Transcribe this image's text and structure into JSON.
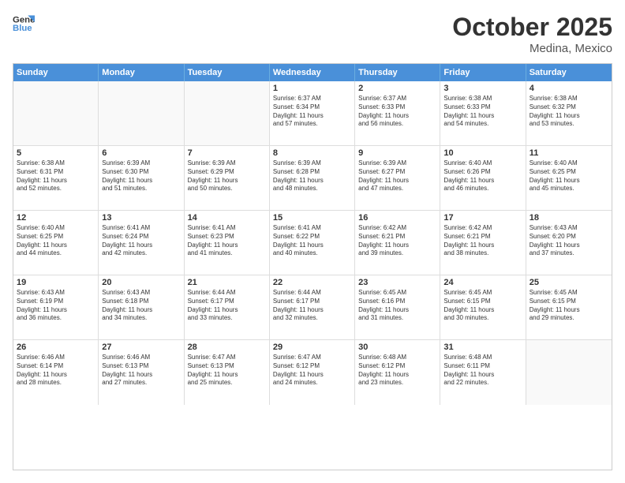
{
  "logo": {
    "line1": "General",
    "line2": "Blue"
  },
  "header": {
    "month_year": "October 2025",
    "location": "Medina, Mexico"
  },
  "day_headers": [
    "Sunday",
    "Monday",
    "Tuesday",
    "Wednesday",
    "Thursday",
    "Friday",
    "Saturday"
  ],
  "weeks": [
    [
      {
        "date": "",
        "info": ""
      },
      {
        "date": "",
        "info": ""
      },
      {
        "date": "",
        "info": ""
      },
      {
        "date": "1",
        "info": "Sunrise: 6:37 AM\nSunset: 6:34 PM\nDaylight: 11 hours\nand 57 minutes."
      },
      {
        "date": "2",
        "info": "Sunrise: 6:37 AM\nSunset: 6:33 PM\nDaylight: 11 hours\nand 56 minutes."
      },
      {
        "date": "3",
        "info": "Sunrise: 6:38 AM\nSunset: 6:33 PM\nDaylight: 11 hours\nand 54 minutes."
      },
      {
        "date": "4",
        "info": "Sunrise: 6:38 AM\nSunset: 6:32 PM\nDaylight: 11 hours\nand 53 minutes."
      }
    ],
    [
      {
        "date": "5",
        "info": "Sunrise: 6:38 AM\nSunset: 6:31 PM\nDaylight: 11 hours\nand 52 minutes."
      },
      {
        "date": "6",
        "info": "Sunrise: 6:39 AM\nSunset: 6:30 PM\nDaylight: 11 hours\nand 51 minutes."
      },
      {
        "date": "7",
        "info": "Sunrise: 6:39 AM\nSunset: 6:29 PM\nDaylight: 11 hours\nand 50 minutes."
      },
      {
        "date": "8",
        "info": "Sunrise: 6:39 AM\nSunset: 6:28 PM\nDaylight: 11 hours\nand 48 minutes."
      },
      {
        "date": "9",
        "info": "Sunrise: 6:39 AM\nSunset: 6:27 PM\nDaylight: 11 hours\nand 47 minutes."
      },
      {
        "date": "10",
        "info": "Sunrise: 6:40 AM\nSunset: 6:26 PM\nDaylight: 11 hours\nand 46 minutes."
      },
      {
        "date": "11",
        "info": "Sunrise: 6:40 AM\nSunset: 6:25 PM\nDaylight: 11 hours\nand 45 minutes."
      }
    ],
    [
      {
        "date": "12",
        "info": "Sunrise: 6:40 AM\nSunset: 6:25 PM\nDaylight: 11 hours\nand 44 minutes."
      },
      {
        "date": "13",
        "info": "Sunrise: 6:41 AM\nSunset: 6:24 PM\nDaylight: 11 hours\nand 42 minutes."
      },
      {
        "date": "14",
        "info": "Sunrise: 6:41 AM\nSunset: 6:23 PM\nDaylight: 11 hours\nand 41 minutes."
      },
      {
        "date": "15",
        "info": "Sunrise: 6:41 AM\nSunset: 6:22 PM\nDaylight: 11 hours\nand 40 minutes."
      },
      {
        "date": "16",
        "info": "Sunrise: 6:42 AM\nSunset: 6:21 PM\nDaylight: 11 hours\nand 39 minutes."
      },
      {
        "date": "17",
        "info": "Sunrise: 6:42 AM\nSunset: 6:21 PM\nDaylight: 11 hours\nand 38 minutes."
      },
      {
        "date": "18",
        "info": "Sunrise: 6:43 AM\nSunset: 6:20 PM\nDaylight: 11 hours\nand 37 minutes."
      }
    ],
    [
      {
        "date": "19",
        "info": "Sunrise: 6:43 AM\nSunset: 6:19 PM\nDaylight: 11 hours\nand 36 minutes."
      },
      {
        "date": "20",
        "info": "Sunrise: 6:43 AM\nSunset: 6:18 PM\nDaylight: 11 hours\nand 34 minutes."
      },
      {
        "date": "21",
        "info": "Sunrise: 6:44 AM\nSunset: 6:17 PM\nDaylight: 11 hours\nand 33 minutes."
      },
      {
        "date": "22",
        "info": "Sunrise: 6:44 AM\nSunset: 6:17 PM\nDaylight: 11 hours\nand 32 minutes."
      },
      {
        "date": "23",
        "info": "Sunrise: 6:45 AM\nSunset: 6:16 PM\nDaylight: 11 hours\nand 31 minutes."
      },
      {
        "date": "24",
        "info": "Sunrise: 6:45 AM\nSunset: 6:15 PM\nDaylight: 11 hours\nand 30 minutes."
      },
      {
        "date": "25",
        "info": "Sunrise: 6:45 AM\nSunset: 6:15 PM\nDaylight: 11 hours\nand 29 minutes."
      }
    ],
    [
      {
        "date": "26",
        "info": "Sunrise: 6:46 AM\nSunset: 6:14 PM\nDaylight: 11 hours\nand 28 minutes."
      },
      {
        "date": "27",
        "info": "Sunrise: 6:46 AM\nSunset: 6:13 PM\nDaylight: 11 hours\nand 27 minutes."
      },
      {
        "date": "28",
        "info": "Sunrise: 6:47 AM\nSunset: 6:13 PM\nDaylight: 11 hours\nand 25 minutes."
      },
      {
        "date": "29",
        "info": "Sunrise: 6:47 AM\nSunset: 6:12 PM\nDaylight: 11 hours\nand 24 minutes."
      },
      {
        "date": "30",
        "info": "Sunrise: 6:48 AM\nSunset: 6:12 PM\nDaylight: 11 hours\nand 23 minutes."
      },
      {
        "date": "31",
        "info": "Sunrise: 6:48 AM\nSunset: 6:11 PM\nDaylight: 11 hours\nand 22 minutes."
      },
      {
        "date": "",
        "info": ""
      }
    ]
  ]
}
